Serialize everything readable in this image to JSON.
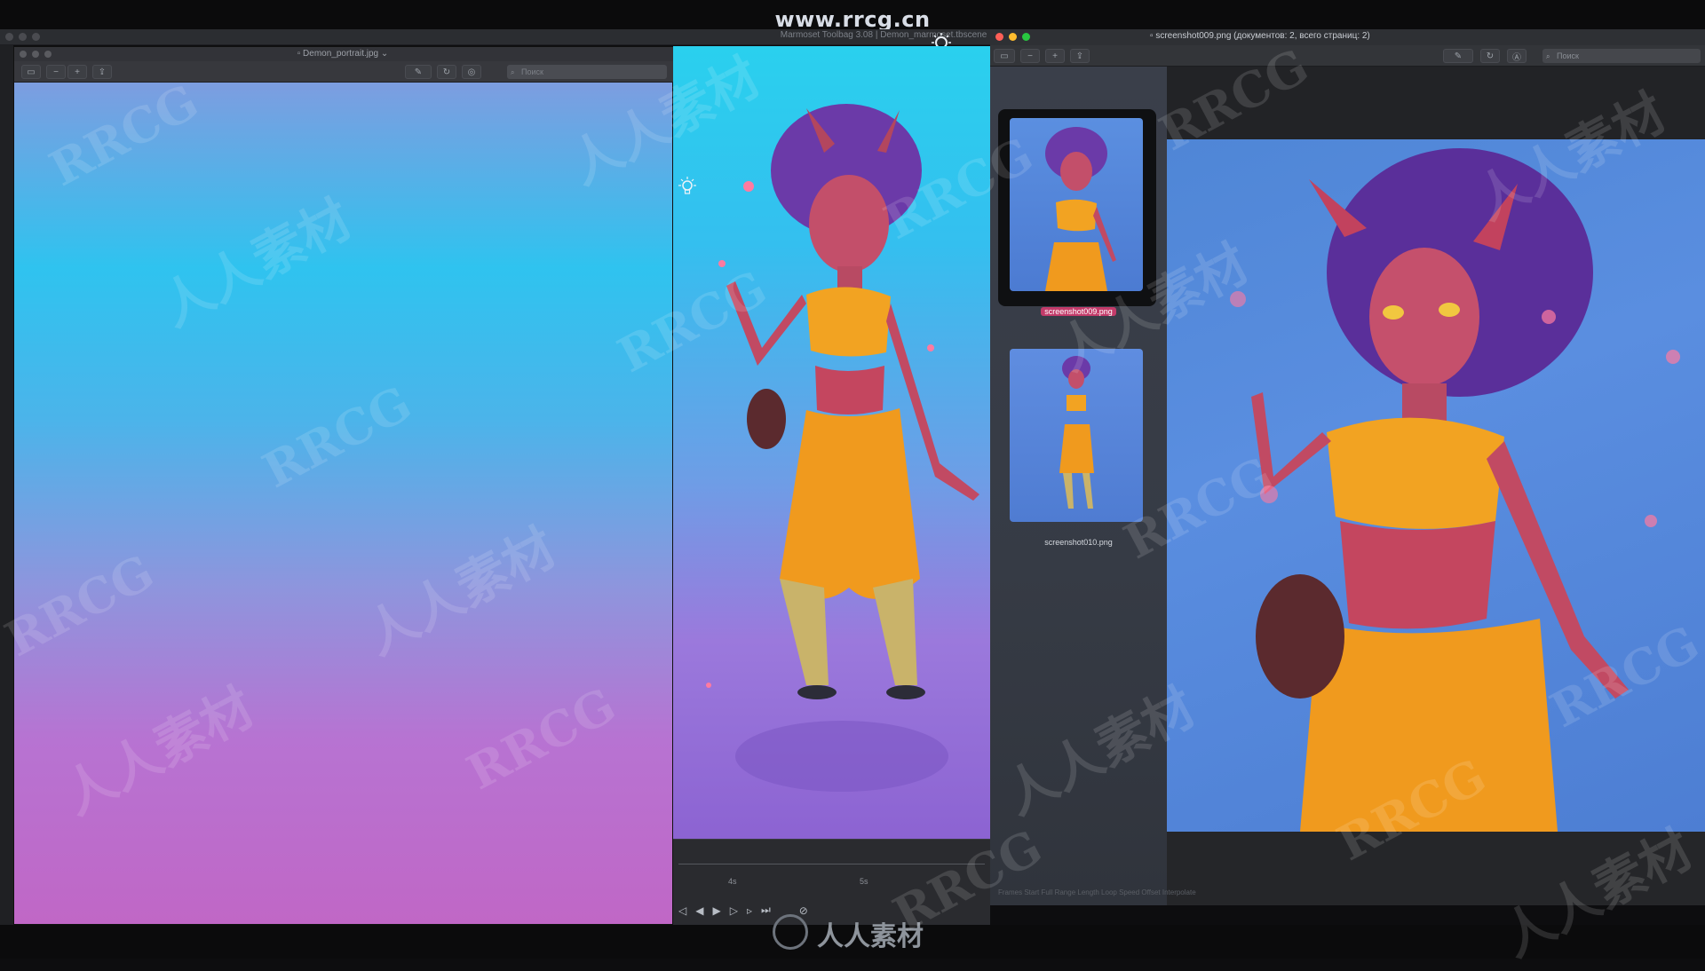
{
  "banner": {
    "site": "www.rrcg.cn"
  },
  "background_app": {
    "title": "Marmoset Toolbag 3.08  |  Demon_marmoset.tbscene"
  },
  "left_window": {
    "title": "Demon_portrait.jpg",
    "search_placeholder": "Поиск",
    "canvas_gradient": [
      "#7d9de0",
      "#2fc3ef",
      "#b773d2",
      "#c067c6"
    ]
  },
  "viewport": {
    "timeline": {
      "marks": [
        "4s",
        "5s"
      ]
    }
  },
  "right_window": {
    "title": "screenshot009.png (документов: 2, всего страниц: 2)",
    "search_placeholder": "Поиск",
    "thumbnails": [
      {
        "label": "screenshot009.png",
        "selected": true
      },
      {
        "label": "screenshot010.png",
        "selected": false
      }
    ],
    "status_line": "Frames  Start  Full  Range  Length  Loop  Speed  Offset  Interpolate"
  },
  "watermarks": {
    "latin": "RRCG",
    "cn": "人人素材"
  },
  "footer_logo": {
    "text": "人人素材"
  },
  "colors": {
    "selection": "#c33b6a",
    "close": "#ff5f57",
    "minimize": "#febc2e",
    "zoom": "#28c840"
  },
  "icons": {
    "left_toolbar": [
      "sidebar-icon",
      "zoom-out-icon",
      "zoom-in-icon",
      "share-icon",
      "markup-icon",
      "rotate-icon",
      "annotate-icon",
      "search-icon"
    ],
    "right_toolbar": [
      "sidebar-icon",
      "zoom-out-icon",
      "zoom-in-icon",
      "share-icon",
      "markup-icon",
      "rotate-icon",
      "annotate-icon",
      "search-icon"
    ]
  }
}
